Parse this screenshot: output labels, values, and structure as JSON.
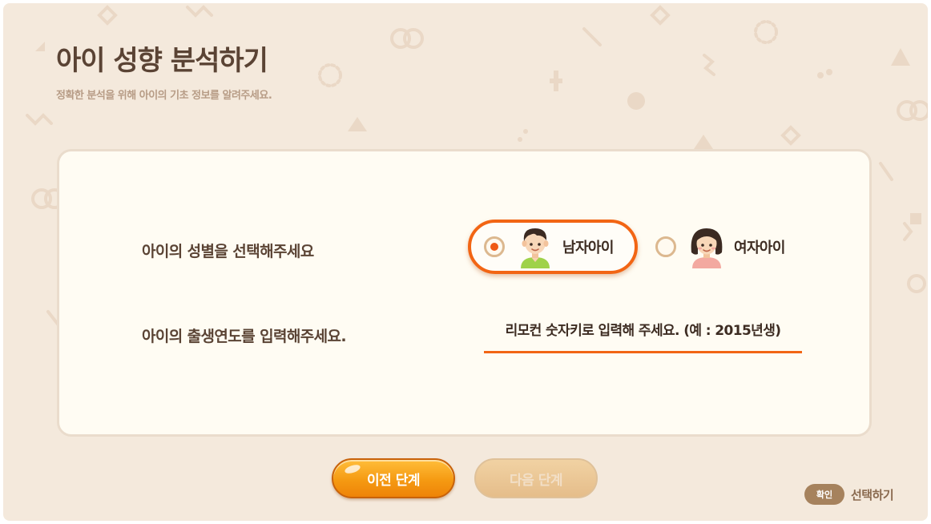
{
  "header": {
    "title": "아이 성향 분석하기",
    "subtitle": "정확한 분석을 위해 아이의 기초 정보를 알려주세요."
  },
  "form": {
    "gender_question": "아이의 성별을 선택해주세요",
    "gender_options": [
      {
        "label": "남자아이",
        "selected": true,
        "icon": "boy-avatar-icon"
      },
      {
        "label": "여자아이",
        "selected": false,
        "icon": "girl-avatar-icon"
      }
    ],
    "birth_question": "아이의 출생연도를 입력해주세요.",
    "birth_input": {
      "value": "",
      "placeholder": "리모컨 숫자키로 입력해 주세요. (예 : 2015년생)"
    }
  },
  "buttons": {
    "prev_label": "이전 단계",
    "next_label": "다음 단계",
    "next_enabled": false
  },
  "hint": {
    "key_label": "확인",
    "action_label": "선택하기"
  },
  "colors": {
    "background": "#f4e9dc",
    "card": "#fffcf3",
    "accent": "#f26514",
    "title": "#5a4334",
    "primary_button": "#f59a12",
    "disabled_button": "#e5bd8a"
  }
}
